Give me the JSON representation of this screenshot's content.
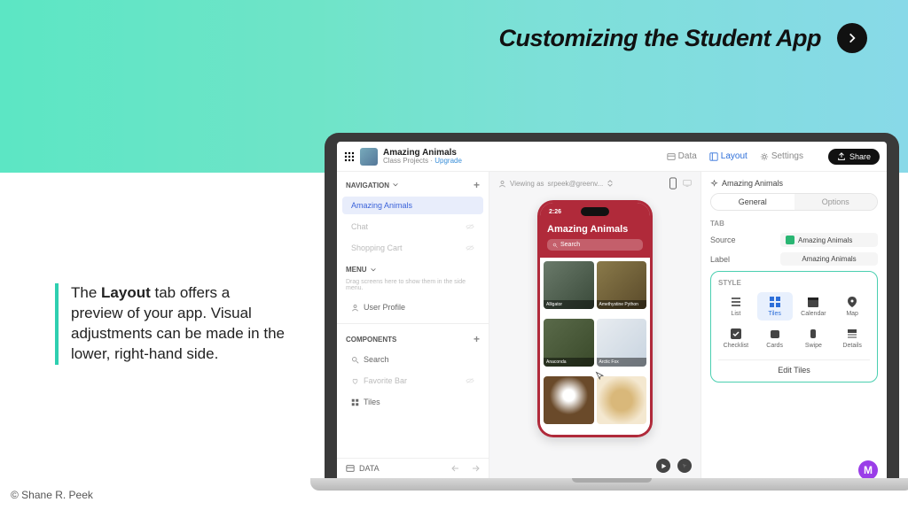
{
  "slide": {
    "title": "Customizing the Student App",
    "caption_parts": {
      "pre": "The ",
      "bold": "Layout",
      "post": " tab offers a preview of your app. Visual adjustments can be made in the lower, right-hand side."
    },
    "copyright": "© Shane R. Peek"
  },
  "app": {
    "grid_label": "App switcher",
    "project": {
      "name": "Amazing Animals",
      "subtitle_prefix": "Class Projects · ",
      "upgrade": "Upgrade"
    },
    "header_tabs": {
      "data": "Data",
      "layout": "Layout",
      "settings": "Settings"
    },
    "share": "Share"
  },
  "sidebar": {
    "navigation": "NAVIGATION",
    "items": [
      {
        "label": "Amazing Animals",
        "active": true
      },
      {
        "label": "Chat",
        "muted": true
      },
      {
        "label": "Shopping Cart",
        "muted": true
      }
    ],
    "menu": "MENU",
    "menu_helper": "Drag screens here to show them in the side menu.",
    "menu_items": [
      {
        "label": "User Profile"
      }
    ],
    "components": "COMPONENTS",
    "component_items": [
      {
        "label": "Search",
        "icon": "search"
      },
      {
        "label": "Favorite Bar",
        "icon": "heart",
        "muted": true
      },
      {
        "label": "Tiles",
        "icon": "grid"
      }
    ],
    "footer": {
      "data": "DATA"
    }
  },
  "canvas": {
    "viewing_prefix": "Viewing as ",
    "viewing_user": "srpeek@greenv..."
  },
  "phone": {
    "time": "2:26",
    "title": "Amazing Animals",
    "search": "Search",
    "tiles": [
      {
        "caption": "Alligator"
      },
      {
        "caption": "Amethystine Python"
      },
      {
        "caption": "Anaconda"
      },
      {
        "caption": "Arctic Fox"
      },
      {
        "caption": ""
      },
      {
        "caption": ""
      }
    ]
  },
  "props": {
    "title": "Amazing Animals",
    "tabs": {
      "general": "General",
      "options": "Options"
    },
    "tab_section": "TAB",
    "source_label": "Source",
    "source_value": "Amazing Animals",
    "label_label": "Label",
    "label_value": "Amazing Animals",
    "style_section": "STYLE",
    "styles": [
      {
        "label": "List"
      },
      {
        "label": "Tiles",
        "active": true
      },
      {
        "label": "Calendar"
      },
      {
        "label": "Map"
      },
      {
        "label": "Checklist"
      },
      {
        "label": "Cards"
      },
      {
        "label": "Swipe"
      },
      {
        "label": "Details"
      }
    ],
    "edit_tiles": "Edit Tiles",
    "badge": "M"
  }
}
